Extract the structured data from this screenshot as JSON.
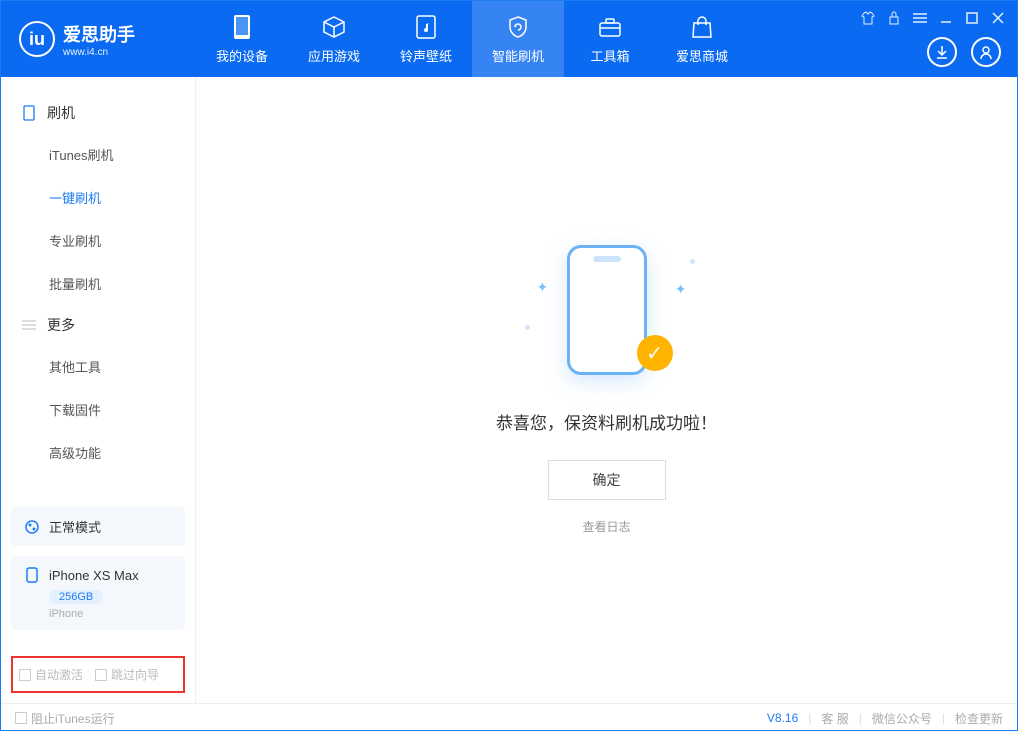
{
  "logo": {
    "title": "爱思助手",
    "subtitle": "www.i4.cn"
  },
  "tabs": {
    "mydevice": "我的设备",
    "appgames": "应用游戏",
    "ringwall": "铃声壁纸",
    "smartflash": "智能刷机",
    "toolbox": "工具箱",
    "store": "爱思商城"
  },
  "sidebar": {
    "group_flash": "刷机",
    "items_flash": [
      "iTunes刷机",
      "一键刷机",
      "专业刷机",
      "批量刷机"
    ],
    "group_more": "更多",
    "items_more": [
      "其他工具",
      "下载固件",
      "高级功能"
    ]
  },
  "mode_card": {
    "label": "正常模式"
  },
  "device_card": {
    "name": "iPhone XS Max",
    "storage": "256GB",
    "type": "iPhone"
  },
  "checkboxes": {
    "auto_activate": "自动激活",
    "skip_guide": "跳过向导"
  },
  "main": {
    "success": "恭喜您，保资料刷机成功啦！",
    "ok": "确定",
    "view_log": "查看日志"
  },
  "footer": {
    "block_itunes": "阻止iTunes运行",
    "version": "V8.16",
    "support": "客 服",
    "wechat": "微信公众号",
    "check_update": "检查更新"
  }
}
